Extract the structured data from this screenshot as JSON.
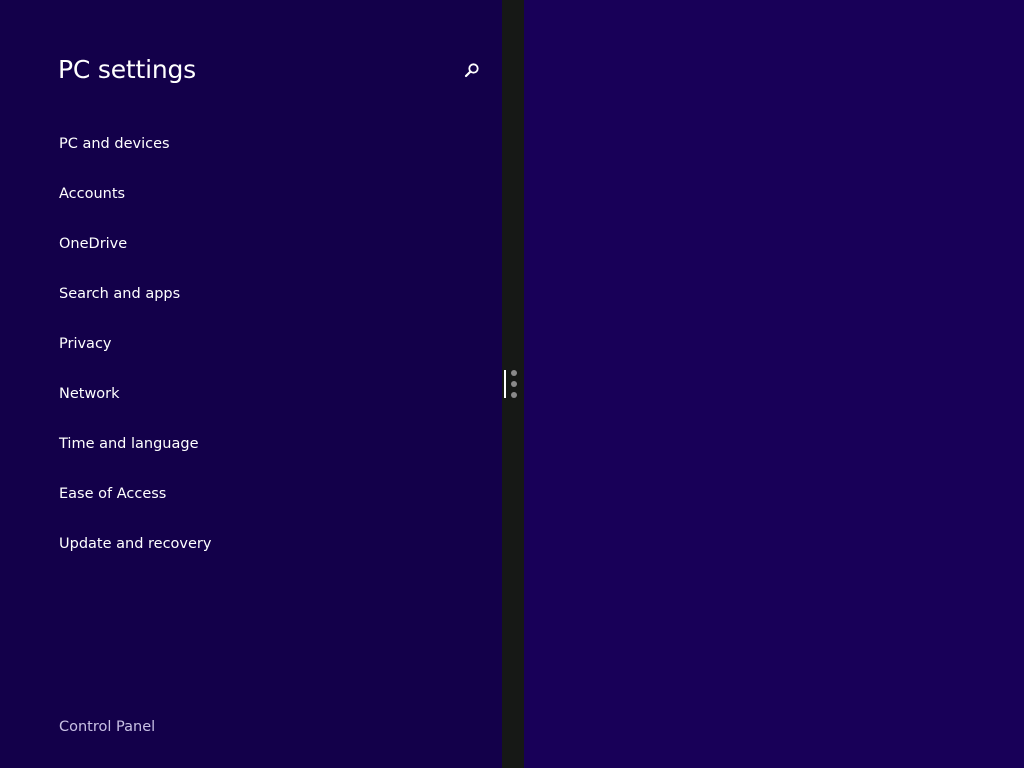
{
  "colors": {
    "left_pane_bg": "#13004a",
    "right_pane_bg": "#180058",
    "splitter_bg": "#161816",
    "text": "#ffffff",
    "secondary_text": "#c8c0e4"
  },
  "header": {
    "title": "PC settings",
    "search_icon": "search-icon"
  },
  "nav": {
    "items": [
      {
        "label": "PC and devices"
      },
      {
        "label": "Accounts"
      },
      {
        "label": "OneDrive"
      },
      {
        "label": "Search and apps"
      },
      {
        "label": "Privacy"
      },
      {
        "label": "Network"
      },
      {
        "label": "Time and language"
      },
      {
        "label": "Ease of Access"
      },
      {
        "label": "Update and recovery"
      }
    ]
  },
  "footer": {
    "control_panel_label": "Control Panel"
  }
}
